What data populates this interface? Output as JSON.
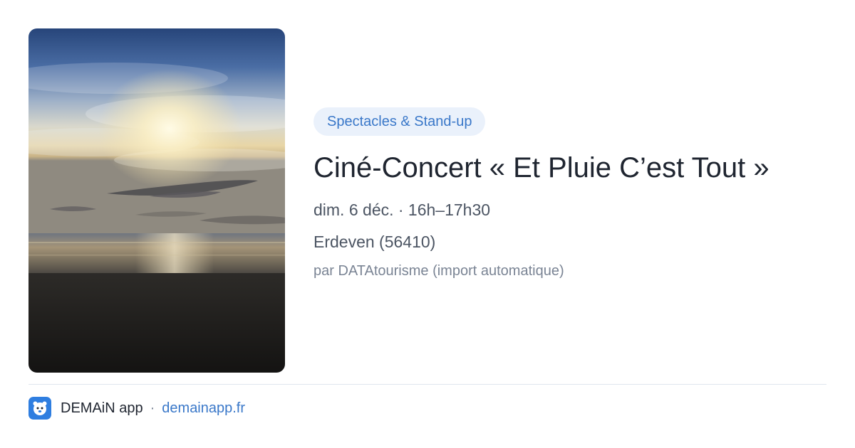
{
  "event": {
    "category": "Spectacles & Stand-up",
    "title": "Ciné-Concert « Et Pluie C’est Tout »",
    "datetime": "dim. 6 déc. · 16h–17h30",
    "location": "Erdeven (56410)",
    "source": "par DATAtourisme (import automatique)"
  },
  "footer": {
    "app_name": "DEMAiN app",
    "separator": "·",
    "app_link": "demainapp.fr"
  },
  "icons": {
    "photo": "sunset-beach-photo",
    "logo": "demain-app-logo-icon"
  },
  "colors": {
    "accent": "#3a78c9",
    "tag_background": "#eaf1fb",
    "title": "#1f2530",
    "secondary_text": "#4c5563",
    "muted_text": "#7a8494",
    "logo_background": "#2f7ee0"
  }
}
